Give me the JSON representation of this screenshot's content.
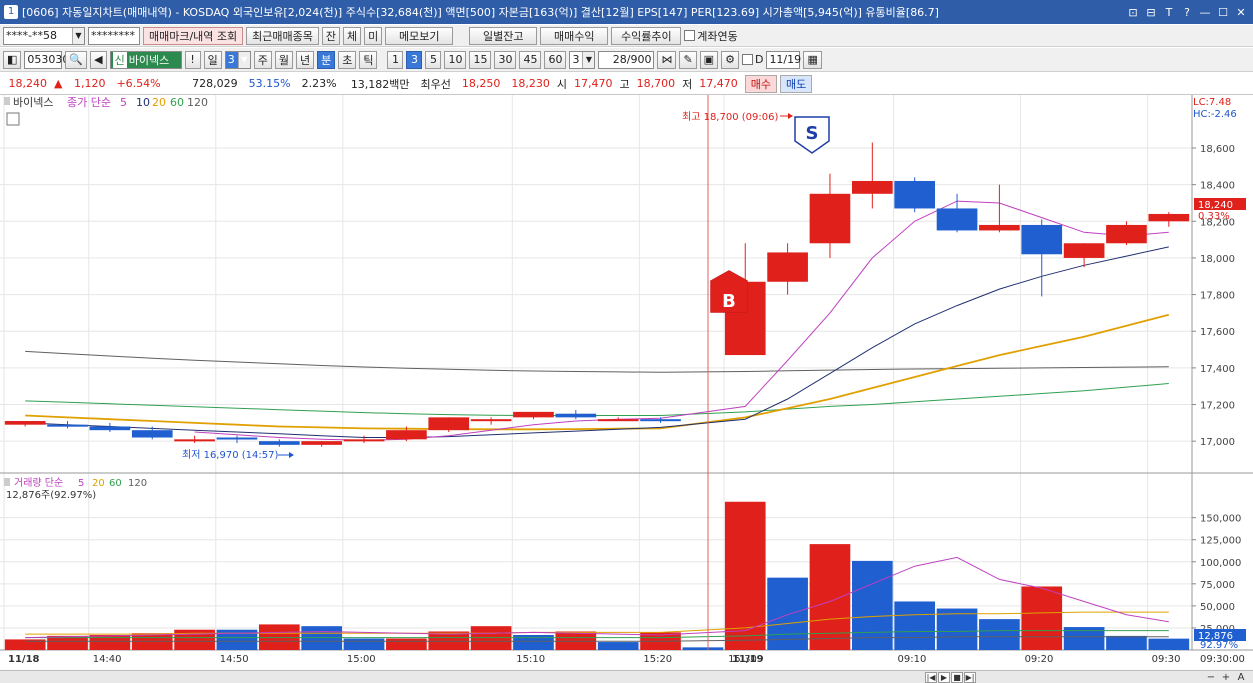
{
  "window": {
    "title": "[0606] 자동일지차트(매매내역) - KOSDAQ 외국인보유[2,024(천)] 주식수[32,684(천)] 액면[500] 자본금[163(억)] 결산[12월] EPS[147] PER[123.69] 시가총액[5,945(억)] 유통비율[86.7]",
    "icon": "1",
    "controls": [
      "⊡",
      "⊟",
      "T",
      "?",
      "—",
      "☐",
      "✕"
    ]
  },
  "toolbar1": {
    "account": "****-**58",
    "password": "********",
    "buttons": [
      "매매마크/내역 조회",
      "최근매매종목",
      "잔",
      "체",
      "미",
      "메모보기",
      "일별잔고",
      "매매수익",
      "수익률추이"
    ],
    "checkbox_label": "계좌연동"
  },
  "toolbar2": {
    "code": "053030",
    "stock_name": "바이넥스",
    "market_badge": "신",
    "period_value": "일",
    "period_num": "3",
    "periods": [
      "주",
      "월",
      "년",
      "분",
      "초",
      "틱"
    ],
    "intervals": [
      "1",
      "3",
      "5",
      "10",
      "15",
      "30",
      "45",
      "60"
    ],
    "interval_sel": "3",
    "count_value": "3",
    "page_current": "28",
    "page_total": "/900",
    "date_value": "11/19",
    "checkbox_label": "D"
  },
  "quote": {
    "price": "18,240",
    "arrow": "▲",
    "change": "1,120",
    "change_pct": "+6.54%",
    "volume": "728,029",
    "vol_ratio": "53.15%",
    "turnover": "2.23%",
    "amount": "13,182백만",
    "best_label": "최우선",
    "ask": "18,250",
    "bid": "18,230",
    "open_label": "시",
    "open": "17,470",
    "high_label": "고",
    "high": "18,700",
    "low_label": "저",
    "low": "17,470",
    "buy_label": "매수",
    "sell_label": "매도"
  },
  "chart_labels": {
    "price_legend": [
      "바이넥스",
      "종가 단순",
      "5",
      "10",
      "20",
      "60",
      "120"
    ],
    "volume_legend": [
      "거래량 단순",
      "5",
      "20",
      "60",
      "120"
    ],
    "volume_info": "12,876주(92.97%)",
    "lc": "LC:7.48",
    "hc": "HC:-2.46",
    "high_annot": "최고 18,700 (09:06)",
    "low_annot": "최저 16,970 (14:57)",
    "cur_price": "18,240",
    "cur_pct": "0.33%",
    "cur_volume": "12,876",
    "cur_vol_pct": "92.97%",
    "buy_marker": "B",
    "sell_marker": "S",
    "time_label": "09:30:00",
    "colors": {
      "up": "#e0201b",
      "down": "#1f5fcf",
      "ma5": "#c040c0",
      "ma10": "#203070",
      "ma20": "#e0a000",
      "ma60": "#30a050",
      "ma120": "#606060"
    }
  },
  "chart_data": {
    "type": "candlestick",
    "price_axis": {
      "ticks": [
        17000,
        17200,
        17400,
        17600,
        17800,
        18000,
        18200,
        18400,
        18600
      ],
      "range": [
        16870,
        18780
      ]
    },
    "volume_axis": {
      "ticks": [
        25000,
        50000,
        75000,
        100000,
        125000,
        150000
      ],
      "range": [
        0,
        170000
      ]
    },
    "time_ticks": [
      "11/18",
      "14:40",
      "14:50",
      "15:00",
      "15:10",
      "15:20",
      "15:30",
      "11/19",
      "09:10",
      "09:20",
      "09:30"
    ],
    "candles": [
      {
        "o": 17090,
        "h": 17100,
        "c": 17110,
        "l": 17080
      },
      {
        "o": 17090,
        "h": 17110,
        "c": 17080,
        "l": 17070
      },
      {
        "o": 17080,
        "h": 17100,
        "c": 17060,
        "l": 17050
      },
      {
        "o": 17060,
        "h": 17080,
        "c": 17020,
        "l": 17010
      },
      {
        "o": 17010,
        "h": 17030,
        "c": 17010,
        "l": 16990
      },
      {
        "o": 17020,
        "h": 17030,
        "c": 17010,
        "l": 16990
      },
      {
        "o": 17000,
        "h": 17010,
        "c": 16980,
        "l": 16970
      },
      {
        "o": 16980,
        "h": 17000,
        "c": 17000,
        "l": 16970
      },
      {
        "o": 17000,
        "h": 17030,
        "c": 17010,
        "l": 16990
      },
      {
        "o": 17010,
        "h": 17080,
        "c": 17060,
        "l": 17000
      },
      {
        "o": 17060,
        "h": 17130,
        "c": 17130,
        "l": 17050
      },
      {
        "o": 17120,
        "h": 17130,
        "c": 17120,
        "l": 17090
      },
      {
        "o": 17130,
        "h": 17160,
        "c": 17160,
        "l": 17120
      },
      {
        "o": 17150,
        "h": 17170,
        "c": 17130,
        "l": 17120
      },
      {
        "o": 17120,
        "h": 17130,
        "c": 17120,
        "l": 17110
      },
      {
        "o": 17120,
        "h": 17130,
        "c": 17110,
        "l": 17100
      },
      {
        "o": 17470,
        "h": 18080,
        "c": 17870,
        "l": 17470
      },
      {
        "o": 17870,
        "h": 18080,
        "c": 18030,
        "l": 17800
      },
      {
        "o": 18080,
        "h": 18460,
        "c": 18350,
        "l": 18000
      },
      {
        "o": 18350,
        "h": 18630,
        "c": 18420,
        "l": 18270
      },
      {
        "o": 18420,
        "h": 18440,
        "c": 18270,
        "l": 18250
      },
      {
        "o": 18270,
        "h": 18350,
        "c": 18150,
        "l": 18140
      },
      {
        "o": 18150,
        "h": 18400,
        "c": 18180,
        "l": 18140
      },
      {
        "o": 18180,
        "h": 18210,
        "c": 18020,
        "l": 17790
      },
      {
        "o": 18000,
        "h": 18080,
        "c": 18080,
        "l": 17950
      },
      {
        "o": 18080,
        "h": 18200,
        "c": 18180,
        "l": 18070
      },
      {
        "o": 18200,
        "h": 18250,
        "c": 18240,
        "l": 18170
      }
    ],
    "volumes": [
      {
        "v": 12000,
        "up": true
      },
      {
        "v": 16000,
        "up": true
      },
      {
        "v": 17000,
        "up": true
      },
      {
        "v": 19000,
        "up": true
      },
      {
        "v": 23000,
        "up": true
      },
      {
        "v": 23000,
        "up": false
      },
      {
        "v": 29000,
        "up": true
      },
      {
        "v": 27000,
        "up": false
      },
      {
        "v": 13000,
        "up": false
      },
      {
        "v": 13000,
        "up": true
      },
      {
        "v": 21000,
        "up": true
      },
      {
        "v": 27000,
        "up": true
      },
      {
        "v": 17000,
        "up": false
      },
      {
        "v": 21000,
        "up": true
      },
      {
        "v": 9000,
        "up": false
      },
      {
        "v": 20000,
        "up": true
      },
      {
        "v": 3000,
        "up": false
      },
      {
        "v": 168000,
        "up": true
      },
      {
        "v": 82000,
        "up": false
      },
      {
        "v": 120000,
        "up": true
      },
      {
        "v": 101000,
        "up": false
      },
      {
        "v": 55000,
        "up": false
      },
      {
        "v": 47000,
        "up": false
      },
      {
        "v": 35000,
        "up": false
      },
      {
        "v": 72000,
        "up": true
      },
      {
        "v": 26000,
        "up": false
      },
      {
        "v": 16000,
        "up": false
      },
      {
        "v": 12876,
        "up": false
      }
    ],
    "ma": {
      "ma5": [
        null,
        null,
        null,
        null,
        17050,
        17035,
        17020,
        17010,
        17005,
        17010,
        17030,
        17060,
        17090,
        17110,
        17120,
        17125,
        17190,
        17440,
        17700,
        18000,
        18200,
        18310,
        18300,
        18220,
        18140,
        18120,
        18140
      ],
      "ma10": [
        17100,
        17090,
        17080,
        17070,
        17060,
        17050,
        17040,
        17030,
        17020,
        17020,
        17025,
        17035,
        17045,
        17055,
        17065,
        17075,
        17120,
        17230,
        17370,
        17510,
        17640,
        17740,
        17830,
        17900,
        17960,
        18010,
        18060
      ],
      "ma20": [
        17140,
        17130,
        17120,
        17110,
        17100,
        17090,
        17080,
        17075,
        17070,
        17068,
        17066,
        17065,
        17065,
        17066,
        17068,
        17070,
        17130,
        17180,
        17230,
        17290,
        17350,
        17410,
        17470,
        17520,
        17570,
        17630,
        17690
      ],
      "ma60": [
        17220,
        17212,
        17204,
        17196,
        17188,
        17180,
        17172,
        17164,
        17156,
        17150,
        17145,
        17142,
        17140,
        17140,
        17140,
        17140,
        17160,
        17175,
        17190,
        17200,
        17215,
        17230,
        17245,
        17260,
        17275,
        17295,
        17315
      ],
      "ma120": [
        17490,
        17477,
        17465,
        17453,
        17442,
        17432,
        17422,
        17413,
        17405,
        17398,
        17392,
        17387,
        17383,
        17380,
        17378,
        17376,
        17380,
        17384,
        17388,
        17391,
        17394,
        17396,
        17398,
        17400,
        17402,
        17404,
        17406
      ],
      "vma5": [
        14000,
        15000,
        16000,
        17000,
        18000,
        19000,
        20000,
        21000,
        20000,
        19000,
        18000,
        19000,
        20000,
        19000,
        18000,
        17000,
        22000,
        40000,
        55000,
        75000,
        95000,
        105000,
        80000,
        70000,
        55000,
        40000,
        32000
      ],
      "vma20": [
        18000,
        18000,
        18000,
        18000,
        19000,
        19000,
        19000,
        19000,
        19000,
        19000,
        19000,
        19000,
        20000,
        20000,
        20000,
        20000,
        25000,
        30000,
        35000,
        38000,
        40000,
        41000,
        41000,
        42000,
        43000,
        43000,
        43000
      ],
      "vma60": [
        14000,
        14000,
        14000,
        14000,
        14000,
        14000,
        14000,
        14000,
        14000,
        14000,
        14000,
        14000,
        14000,
        14000,
        14000,
        14000,
        16000,
        18000,
        19000,
        20000,
        21000,
        21000,
        22000,
        22000,
        22000,
        22000,
        22000
      ],
      "vma120": [
        10000,
        10000,
        10000,
        10000,
        10000,
        10000,
        10000,
        10000,
        10000,
        10000,
        10000,
        10000,
        10000,
        10000,
        10000,
        10000,
        11000,
        12000,
        13000,
        14000,
        14000,
        15000,
        15000,
        15000,
        15000,
        15000,
        15000
      ]
    }
  }
}
